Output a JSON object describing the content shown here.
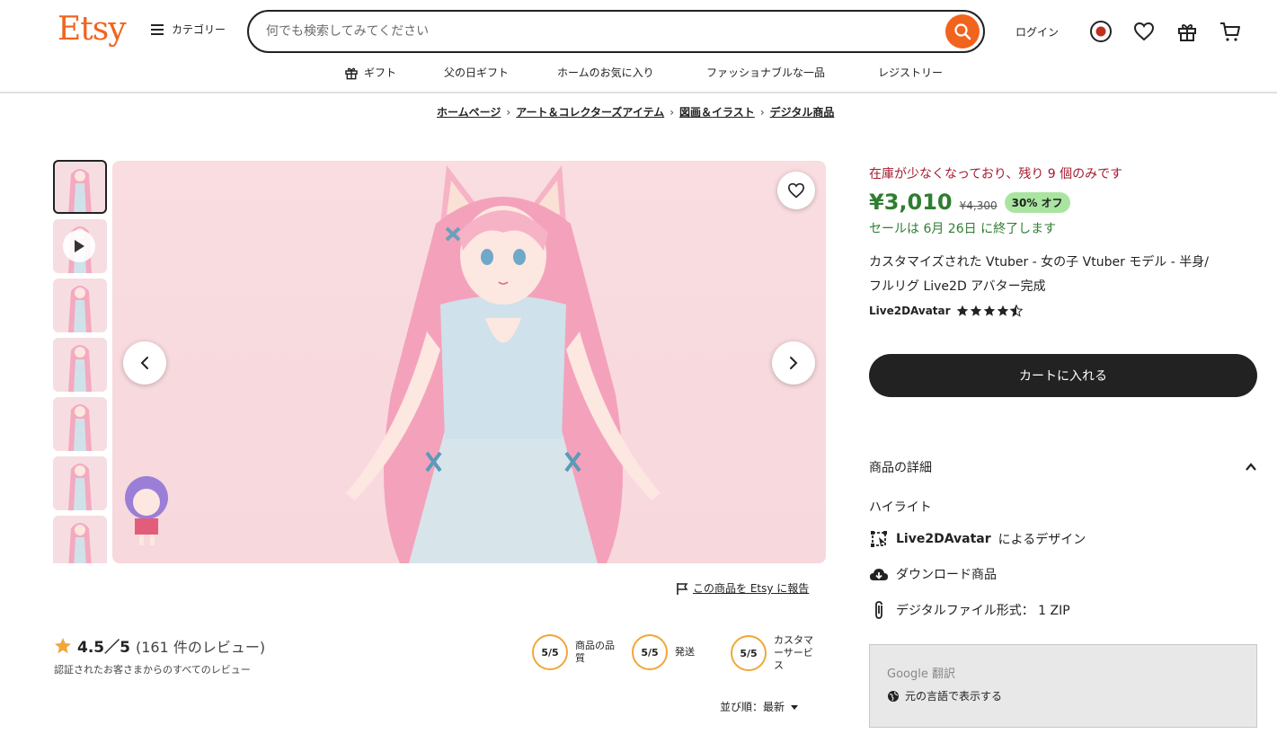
{
  "header": {
    "logo": "Etsy",
    "categories_label": "カテゴリー",
    "search_placeholder": "何でも検索してみてください",
    "login_label": "ログイン"
  },
  "subnav": {
    "items": [
      "ギフト",
      "父の日ギフト",
      "ホームのお気に入り",
      "ファッショナブルな一品",
      "レジストリー"
    ]
  },
  "breadcrumb": {
    "items": [
      "ホームページ",
      "アート＆コレクターズアイテム",
      "図画＆イラスト",
      "デジタル商品"
    ]
  },
  "gallery": {
    "report_label": "この商品を Etsy に報告"
  },
  "reviews": {
    "score": "4.5／5",
    "count": "(161 件のレビュー)",
    "subtitle": "認証されたお客さまからのすべてのレビュー",
    "metrics": [
      {
        "value": "5/5",
        "label_line1": "商品の品",
        "label_line2": "質",
        "label_line3": ""
      },
      {
        "value": "5/5",
        "label_line1": "発送",
        "label_line2": "",
        "label_line3": ""
      },
      {
        "value": "5/5",
        "label_line1": "カスタマ",
        "label_line2": "ーサービ",
        "label_line3": "ス"
      }
    ],
    "sort_label": "並び順：最新"
  },
  "product": {
    "stock_notice": "在庫が少なくなっており、残り 9 個のみです",
    "price": "¥3,010",
    "original_price": "¥4,300",
    "discount_badge": "30% オフ",
    "sale_end": "セールは 6月 26日 に終了します",
    "title_line1": "カスタマイズされた Vtuber - 女の子 Vtuber モデル - 半身/",
    "title_line2": "フルリグ Live2D アバター完成",
    "seller": "Live2DAvatar",
    "rating_stars": 4.5,
    "add_to_cart_label": "カートに入れる"
  },
  "details": {
    "header_label": "商品の詳細",
    "highlights_title": "ハイライト",
    "designer_name": "Live2DAvatar",
    "designer_suffix": "によるデザイン",
    "download_label": "ダウンロード商品",
    "file_format_label": "デジタルファイル形式： 1 ZIP"
  },
  "translate": {
    "title": "Google 翻訳",
    "show_original": "元の言語で表示する"
  },
  "colors": {
    "brand": "#f1641e",
    "price_green": "#2f7d32",
    "stock_red": "#a61a2e",
    "badge_green": "#a9e5a0",
    "rating_ring": "#f0a73a"
  }
}
